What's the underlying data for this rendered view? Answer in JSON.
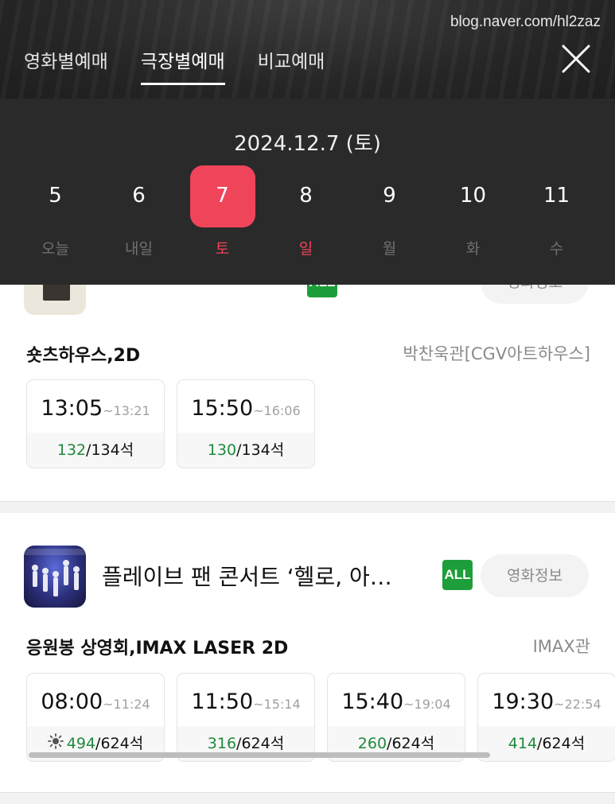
{
  "watermark": "blog.naver.com/hl2zaz",
  "tabs": [
    {
      "label": "영화별예매",
      "active": false
    },
    {
      "label": "극장별예매",
      "active": true
    },
    {
      "label": "비교예매",
      "active": false
    }
  ],
  "date_title": "2024.12.7 (토)",
  "days": [
    {
      "num": "5",
      "label": "오늘"
    },
    {
      "num": "6",
      "label": "내일"
    },
    {
      "num": "7",
      "label": "토"
    },
    {
      "num": "8",
      "label": "일"
    },
    {
      "num": "9",
      "label": "월"
    },
    {
      "num": "10",
      "label": "화"
    },
    {
      "num": "11",
      "label": "수"
    }
  ],
  "selected_day": "7",
  "colors": {
    "accent": "#f0445a",
    "rating_all": "#1e9e3a",
    "seats_available": "#1e8a3c"
  },
  "movies": [
    {
      "title": "",
      "rating": "ALL",
      "info_label": "영화정보",
      "format": "숏츠하우스,2D",
      "hall": "박찬욱관[CGV아트하우스]",
      "showtimes": [
        {
          "start": "13:05",
          "end": "~13:21",
          "available": "132",
          "total": "/134석"
        },
        {
          "start": "15:50",
          "end": "~16:06",
          "available": "130",
          "total": "/134석"
        }
      ]
    },
    {
      "title": "플레이브 팬 콘서트 ‘헬로, 아…",
      "rating": "ALL",
      "info_label": "영화정보",
      "format": "응원봉 상영회,IMAX LASER 2D",
      "hall": "IMAX관",
      "showtimes": [
        {
          "start": "08:00",
          "end": "~11:24",
          "available": "494",
          "total": "/624석",
          "icon": "sun-icon"
        },
        {
          "start": "11:50",
          "end": "~15:14",
          "available": "316",
          "total": "/624석"
        },
        {
          "start": "15:40",
          "end": "~19:04",
          "available": "260",
          "total": "/624석"
        },
        {
          "start": "19:30",
          "end": "~22:54",
          "available": "414",
          "total": "/624석"
        }
      ]
    }
  ]
}
